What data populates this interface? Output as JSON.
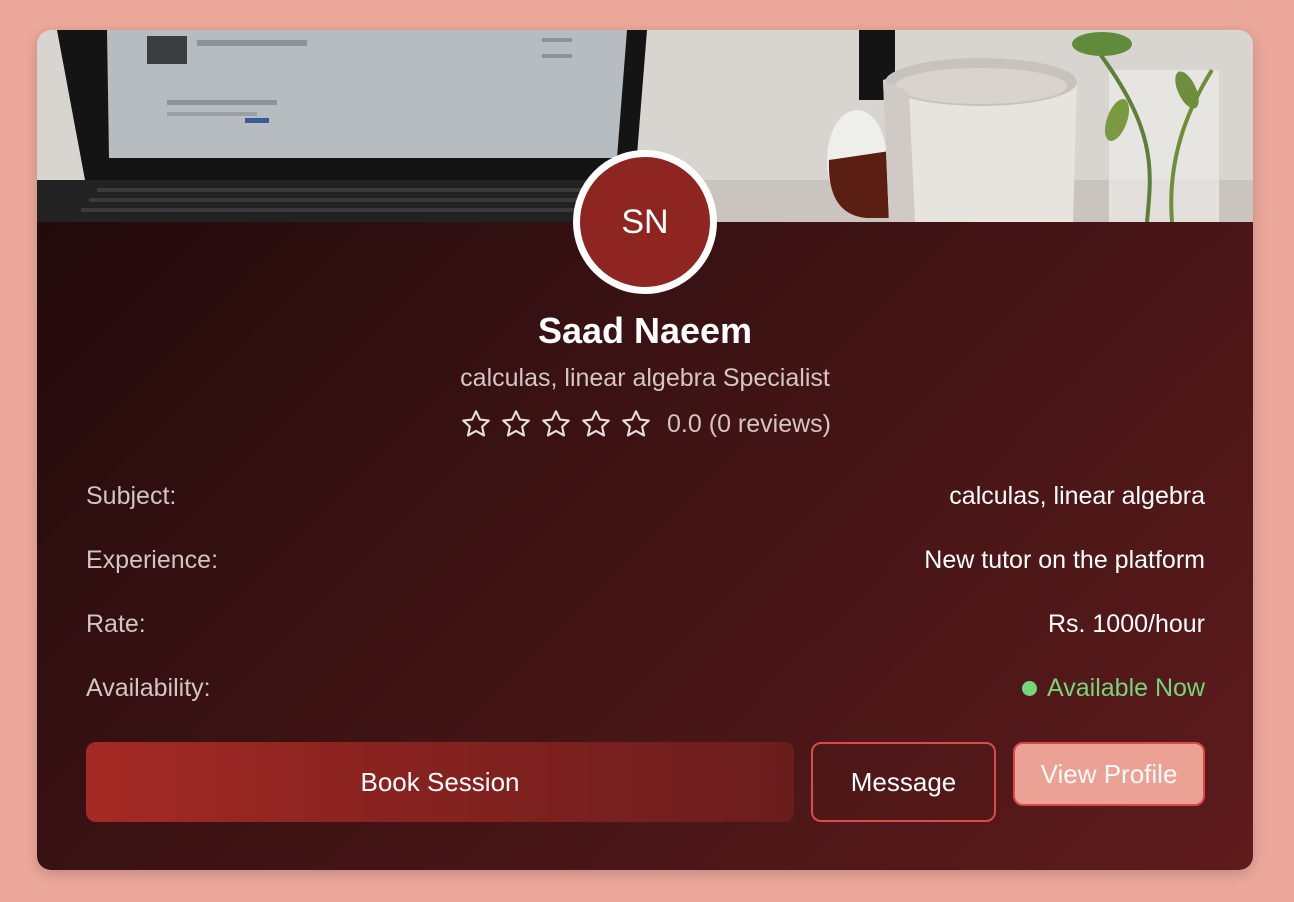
{
  "tutor": {
    "initials": "SN",
    "name": "Saad Naeem",
    "specialty": "calculas, linear algebra Specialist",
    "rating": {
      "stars_total": 5,
      "stars_filled": 0,
      "score": "0.0",
      "reviews": "(0 reviews)"
    }
  },
  "details": {
    "subject": {
      "label": "Subject:",
      "value": "calculas, linear algebra"
    },
    "experience": {
      "label": "Experience:",
      "value": "New tutor on the platform"
    },
    "rate": {
      "label": "Rate:",
      "value": "Rs. 1000/hour"
    },
    "availability": {
      "label": "Availability:",
      "value": "Available Now",
      "status_color": "#73d67b"
    }
  },
  "actions": {
    "book_label": "Book Session",
    "message_label": "Message",
    "view_profile_label": "View Profile"
  },
  "colors": {
    "page_background": "#eca89b",
    "avatar_background": "#8e2521",
    "primary_button": "#a52a25",
    "accent_border": "#d94c4a"
  },
  "icons": {
    "rating_star": "star-outline-icon",
    "availability_dot": "status-dot-icon"
  }
}
